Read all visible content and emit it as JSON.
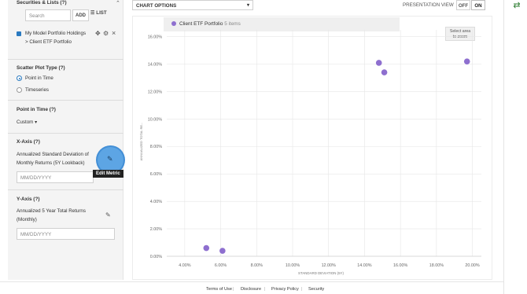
{
  "sidebar": {
    "securities_title": "Securities & Lists (?)",
    "search_placeholder": "Search",
    "add_label": "ADD",
    "list_label": "LIST",
    "list_icon": "list-icon",
    "portfolio": {
      "text": "My Model Portfolio Holdings > Client ETF Portfolio",
      "checked": true
    },
    "scatter_title": "Scatter Plot Type (?)",
    "scatter_options": [
      {
        "label": "Point in Time",
        "selected": true
      },
      {
        "label": "Timeseries",
        "selected": false
      }
    ],
    "pit_title": "Point in Time (?)",
    "pit_value": "Custom",
    "xaxis_title": "X-Axis (?)",
    "xaxis_metric": "Annualized Standard Deviation of Monthly Returns (5Y Lookback)",
    "xaxis_date_placeholder": "MM/DD/YYYY",
    "edit_tooltip": "Edit Metric",
    "yaxis_title": "Y-Axis (?)",
    "yaxis_metric": "Annualized 5 Year Total Returns (Monthly)",
    "yaxis_date_placeholder": "MM/DD/YYYY"
  },
  "topbar": {
    "chart_options_label": "CHART OPTIONS",
    "presentation_label": "PRESENTATION VIEW",
    "off_label": "OFF",
    "on_label": "ON",
    "presentation_on": true
  },
  "legend": {
    "name": "Client ETF Portfolio",
    "count": "5 items",
    "color": "#8e6fcf"
  },
  "zoom_hint": [
    "Select area",
    "to zoom"
  ],
  "chart_data": {
    "type": "scatter",
    "title": "",
    "xlabel": "STANDARD DEVIATION (5Y)",
    "ylabel": "ANNUALIZED TOTAL RE...",
    "x_ticks": [
      "4.00%",
      "6.00%",
      "8.00%",
      "10.00%",
      "12.00%",
      "14.00%",
      "16.00%",
      "18.00%",
      "20.00%"
    ],
    "y_ticks": [
      "0.00%",
      "2.00%",
      "4.00%",
      "6.00%",
      "8.00%",
      "10.00%",
      "12.00%",
      "14.00%",
      "16.00%"
    ],
    "xlim": [
      3.0,
      20.5
    ],
    "ylim": [
      0,
      16.5
    ],
    "grid": true,
    "series": [
      {
        "name": "Client ETF Portfolio",
        "color": "#8e6fcf",
        "points": [
          {
            "x": 5.2,
            "y": 0.6
          },
          {
            "x": 6.1,
            "y": 0.4
          },
          {
            "x": 14.8,
            "y": 14.1
          },
          {
            "x": 15.1,
            "y": 13.4
          },
          {
            "x": 19.7,
            "y": 14.2
          }
        ]
      }
    ]
  },
  "footer": {
    "links": [
      "Terms of Use",
      "Disclosure",
      "Privacy Policy",
      "Security"
    ]
  },
  "right_rail": {
    "icon": "refresh-icon"
  }
}
